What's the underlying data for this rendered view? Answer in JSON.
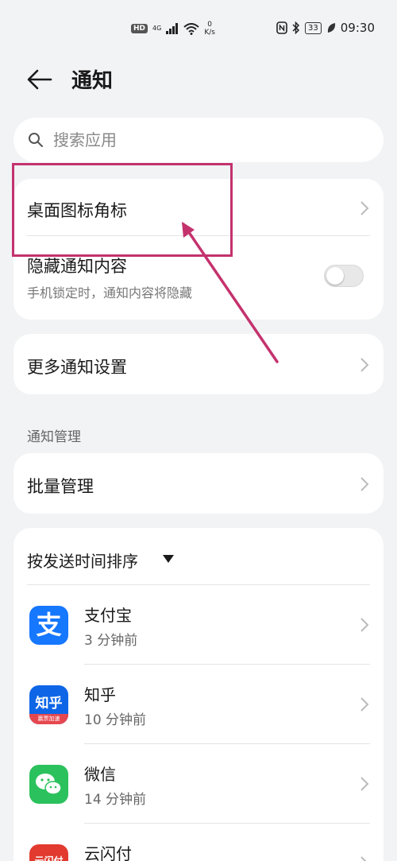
{
  "status_bar": {
    "hd": "HD",
    "network": "4G",
    "speed_value": "0",
    "speed_unit": "K/s",
    "battery": "33",
    "time": "09:30"
  },
  "header": {
    "title": "通知"
  },
  "search": {
    "placeholder": "搜索应用"
  },
  "card1": {
    "badge_label": "桌面图标角标",
    "hide_label": "隐藏通知内容",
    "hide_sub": "手机锁定时，通知内容将隐藏",
    "hide_enabled": false
  },
  "card2": {
    "more_label": "更多通知设置"
  },
  "section": {
    "label": "通知管理"
  },
  "card3": {
    "batch_label": "批量管理"
  },
  "apps": {
    "sort_label": "按发送时间排序",
    "items": [
      {
        "name": "支付宝",
        "time": "3 分钟前",
        "icon": "alipay-icon",
        "color": "#1677ff"
      },
      {
        "name": "知乎",
        "time": "10 分钟前",
        "icon": "zhihu-icon",
        "color": "#0e66e7"
      },
      {
        "name": "微信",
        "time": "14 分钟前",
        "icon": "wechat-icon",
        "color": "#2bc15c"
      },
      {
        "name": "云闪付",
        "time": "",
        "icon": "unionpay-icon",
        "color": "#e23a2e"
      }
    ],
    "zhihu_icon_text": "知乎",
    "zhihu_icon_sub": "赢票加速",
    "alipay_icon_text": "支",
    "unionpay_icon_text": "云闪付"
  },
  "colors": {
    "annotation": "#c4326e",
    "background": "#f1f3f5"
  }
}
